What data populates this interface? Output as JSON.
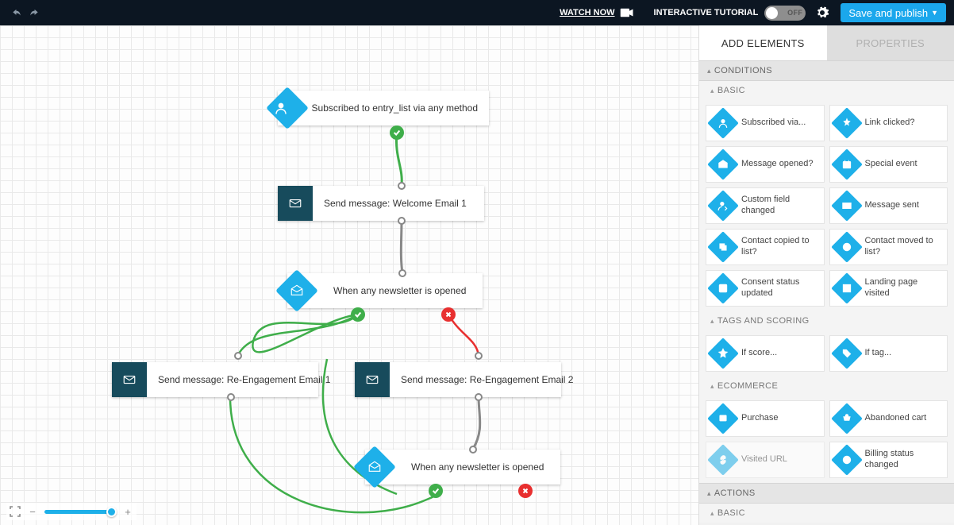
{
  "topbar": {
    "watch_now": "WATCH NOW",
    "tutorial": "INTERACTIVE TUTORIAL",
    "toggle": "OFF",
    "save": "Save and publish"
  },
  "flow": {
    "n1": "Subscribed to entry_list via any method",
    "n2": "Send message: Welcome Email 1",
    "n3": "When any newsletter is opened",
    "n4": "Send message: Re-Engagement Email 1",
    "n5": "Send message: Re-Engagement Email 2",
    "n6": "When any newsletter is opened"
  },
  "sidebar": {
    "tabs": {
      "add": "ADD ELEMENTS",
      "props": "PROPERTIES"
    },
    "sections": {
      "conditions": "CONDITIONS",
      "actions": "ACTIONS"
    },
    "subs": {
      "basic": "BASIC",
      "tags": "TAGS AND SCORING",
      "ecom": "ECOMMERCE",
      "basic2": "BASIC"
    },
    "items": {
      "subscribed": "Subscribed via...",
      "link_clicked": "Link clicked?",
      "msg_opened": "Message opened?",
      "special_event": "Special event",
      "custom_field": "Custom field changed",
      "msg_sent": "Message sent",
      "copied": "Contact copied to list?",
      "moved": "Contact moved to list?",
      "consent": "Consent status updated",
      "landing": "Landing page visited",
      "if_score": "If score...",
      "if_tag": "If tag...",
      "purchase": "Purchase",
      "abandoned": "Abandoned cart",
      "visited_url": "Visited URL",
      "billing": "Billing status changed"
    }
  }
}
